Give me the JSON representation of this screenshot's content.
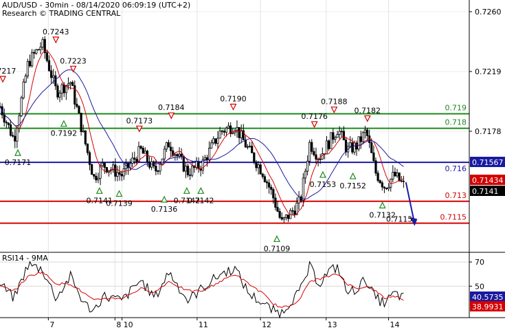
{
  "header": {
    "title": "AUD/USD - 30min - 08/14/2020 06:09:19 (UTC+2)",
    "subtitle": "Research © TRADING CENTRAL"
  },
  "indicator": {
    "label": "RSI14 - 9MA"
  },
  "colors": {
    "candle": "#000000",
    "ma_fast": "#d40000",
    "ma_slow": "#1a1aa0",
    "support": "#d40000",
    "resistance": "#1b8a1b",
    "pivot": "#1a1aa0",
    "arrow": "#1a1aa0",
    "rsi": "#000000",
    "rsi_ma": "#d40000"
  },
  "chart_data": [
    {
      "type": "candlestick",
      "x_ticks": [
        "7",
        "8",
        "10",
        "11",
        "12",
        "13",
        "14"
      ],
      "y_ticks": [
        "0.7260",
        "0.7219",
        "0.7178"
      ],
      "ylim": [
        0.7095,
        0.7268
      ],
      "price_axis_badges": [
        {
          "text": "0.71567",
          "value": 0.71567,
          "color": "#1a1aa0"
        },
        {
          "text": "0.71434",
          "value": 0.71434,
          "color": "#d40000"
        },
        {
          "text": "0.7141",
          "value": 0.7141,
          "color": "#000000"
        }
      ],
      "levels": [
        {
          "label": "0.719",
          "value": 0.719,
          "kind": "resistance"
        },
        {
          "label": "0.718",
          "value": 0.718,
          "kind": "resistance"
        },
        {
          "label": "0.716",
          "value": 0.71567,
          "kind": "pivot"
        },
        {
          "label": "0.713",
          "value": 0.713,
          "kind": "support"
        },
        {
          "label": "0.7115",
          "value": 0.7115,
          "kind": "support"
        }
      ],
      "peaks": [
        {
          "label": "0.7217",
          "x": 0.006,
          "value": 0.7209
        },
        {
          "label": "0.7243",
          "x": 0.119,
          "value": 0.7236
        },
        {
          "label": "0.7223",
          "x": 0.156,
          "value": 0.7216
        },
        {
          "label": "0.7173",
          "x": 0.297,
          "value": 0.7175
        },
        {
          "label": "0.7184",
          "x": 0.365,
          "value": 0.7184
        },
        {
          "label": "0.7190",
          "x": 0.497,
          "value": 0.719
        },
        {
          "label": "0.7176",
          "x": 0.67,
          "value": 0.7178
        },
        {
          "label": "0.7188",
          "x": 0.712,
          "value": 0.7188
        },
        {
          "label": "0.7182",
          "x": 0.783,
          "value": 0.7182
        }
      ],
      "troughs": [
        {
          "label": "0.7192",
          "x": 0.136,
          "value": 0.7188
        },
        {
          "label": "0.7171",
          "x": 0.038,
          "value": 0.7168
        },
        {
          "label": "0.7141",
          "x": 0.212,
          "value": 0.7142
        },
        {
          "label": "0.7139",
          "x": 0.254,
          "value": 0.714
        },
        {
          "label": "0.7136",
          "x": 0.35,
          "value": 0.7136
        },
        {
          "label": "0.7142",
          "x": 0.398,
          "value": 0.7142
        },
        {
          "label": "0.7142",
          "x": 0.428,
          "value": 0.7142
        },
        {
          "label": "0.7109",
          "x": 0.59,
          "value": 0.7109
        },
        {
          "label": "0.7153",
          "x": 0.688,
          "value": 0.7153
        },
        {
          "label": "0.7152",
          "x": 0.752,
          "value": 0.7152
        },
        {
          "label": "0.7132",
          "x": 0.815,
          "value": 0.7132
        }
      ],
      "forecast": {
        "label": "0.7115",
        "from_value": 0.7143,
        "to_value": 0.7115
      },
      "series": [
        {
          "name": "",
          "x": [
            0,
            0.03,
            0.06,
            0.09,
            0.12,
            0.15,
            0.18,
            0.2,
            0.22,
            0.26,
            0.3,
            0.33,
            0.36,
            0.4,
            0.43,
            0.47,
            0.5,
            0.53,
            0.56,
            0.58,
            0.6,
            0.62,
            0.64,
            0.66,
            0.68,
            0.7,
            0.72,
            0.74,
            0.76,
            0.78,
            0.8,
            0.82,
            0.84,
            0.86
          ],
          "values": [
            0.7195,
            0.7172,
            0.7225,
            0.7238,
            0.7205,
            0.7212,
            0.7172,
            0.7146,
            0.7155,
            0.7148,
            0.7165,
            0.715,
            0.717,
            0.715,
            0.7155,
            0.7178,
            0.7182,
            0.7165,
            0.715,
            0.7135,
            0.7115,
            0.7122,
            0.713,
            0.717,
            0.716,
            0.717,
            0.718,
            0.7165,
            0.7168,
            0.7178,
            0.715,
            0.714,
            0.7148,
            0.7141
          ]
        }
      ]
    },
    {
      "type": "line",
      "title": "RSI14 - 9MA",
      "y_ticks": [
        "70",
        "50"
      ],
      "ylim": [
        24,
        78
      ],
      "value_badges": [
        {
          "text": "40.5735",
          "value": 40.57,
          "color": "#1a1aa0"
        },
        {
          "text": "38.9931",
          "value": 38.99,
          "color": "#d40000"
        }
      ],
      "series": [
        {
          "name": "RSI14",
          "x": [
            0,
            0.03,
            0.06,
            0.09,
            0.12,
            0.15,
            0.18,
            0.2,
            0.22,
            0.26,
            0.3,
            0.33,
            0.36,
            0.4,
            0.43,
            0.47,
            0.5,
            0.53,
            0.56,
            0.58,
            0.6,
            0.62,
            0.64,
            0.66,
            0.68,
            0.7,
            0.72,
            0.74,
            0.76,
            0.78,
            0.8,
            0.82,
            0.84,
            0.86
          ],
          "values": [
            52,
            40,
            68,
            64,
            40,
            58,
            35,
            30,
            42,
            38,
            55,
            40,
            62,
            38,
            48,
            60,
            65,
            44,
            36,
            30,
            28,
            38,
            46,
            66,
            52,
            62,
            66,
            44,
            48,
            56,
            40,
            36,
            44,
            40.57
          ]
        },
        {
          "name": "MA9",
          "x": [
            0,
            0.03,
            0.06,
            0.09,
            0.12,
            0.15,
            0.18,
            0.2,
            0.22,
            0.26,
            0.3,
            0.33,
            0.36,
            0.4,
            0.43,
            0.47,
            0.5,
            0.53,
            0.56,
            0.58,
            0.6,
            0.62,
            0.64,
            0.66,
            0.68,
            0.7,
            0.72,
            0.74,
            0.76,
            0.78,
            0.8,
            0.82,
            0.84,
            0.86
          ],
          "values": [
            50,
            46,
            58,
            62,
            52,
            52,
            44,
            38,
            40,
            40,
            48,
            45,
            54,
            46,
            46,
            54,
            60,
            52,
            44,
            36,
            32,
            34,
            40,
            54,
            56,
            58,
            60,
            52,
            48,
            50,
            46,
            40,
            42,
            38.99
          ]
        }
      ]
    }
  ]
}
